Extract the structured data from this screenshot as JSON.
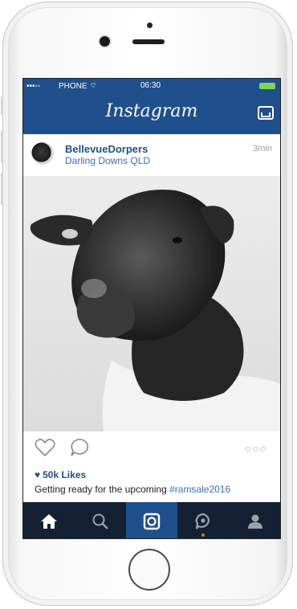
{
  "status_bar": {
    "signal": "•••◦◦",
    "carrier": "PHONE",
    "time": "06:30"
  },
  "app_bar": {
    "title": "Instagram",
    "inbox_icon": "inbox-icon"
  },
  "post": {
    "username": "BellevueDorpers",
    "location": "Darling Downs QLD",
    "time_ago": "3min",
    "photo_alt": "sheep-photo",
    "likes": "50k Likes",
    "caption_text": "Getting ready for the upcoming ",
    "caption_tag": "#ramsale2016",
    "more_label": "○○○"
  },
  "tabs": [
    {
      "name": "home",
      "icon": "home-icon"
    },
    {
      "name": "search",
      "icon": "search-icon"
    },
    {
      "name": "camera",
      "icon": "camera-icon"
    },
    {
      "name": "activity",
      "icon": "activity-icon"
    },
    {
      "name": "profile",
      "icon": "profile-icon"
    }
  ],
  "colors": {
    "brand": "#1f4f8d",
    "tab_bar": "#142133",
    "battery": "#7ed957",
    "notification": "#e8702a"
  }
}
